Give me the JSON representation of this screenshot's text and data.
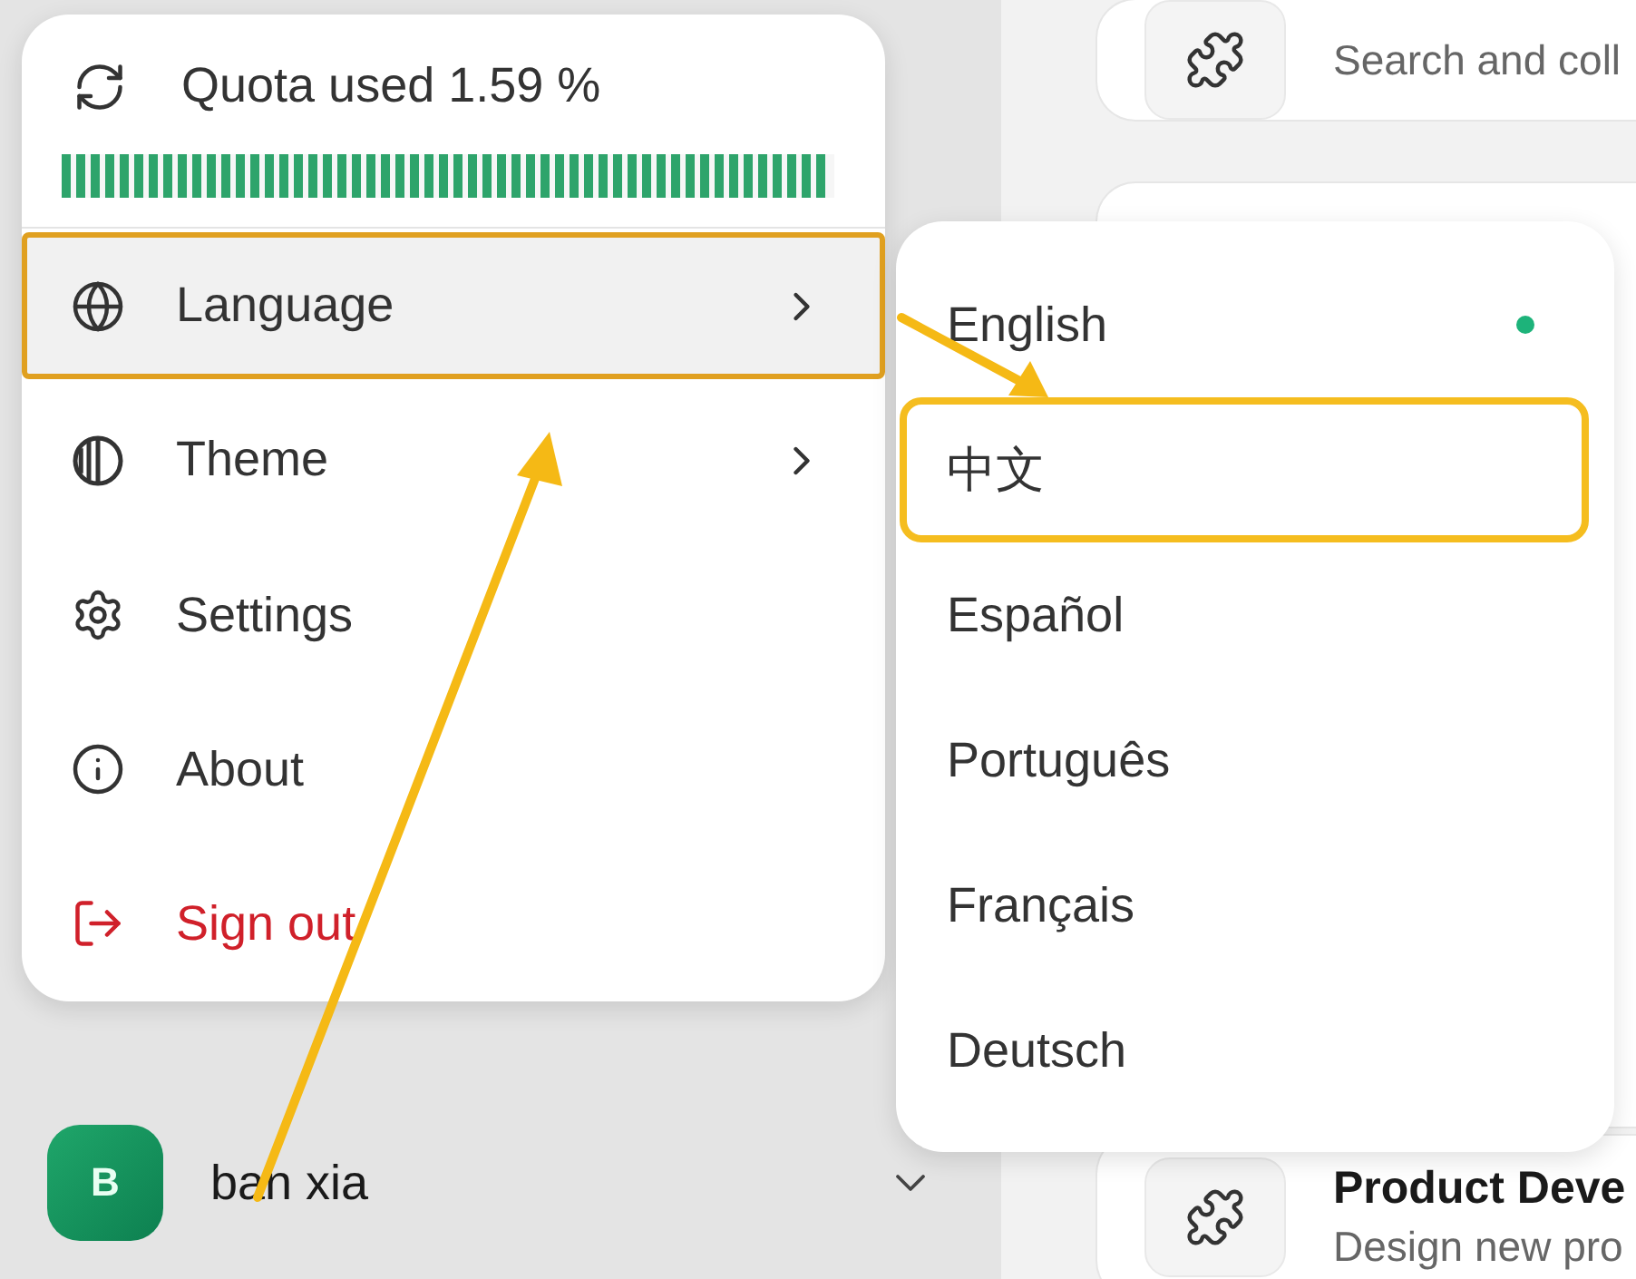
{
  "quota": {
    "label": "Quota used 1.59 %",
    "level": 0.99
  },
  "menu": [
    {
      "kind": "language",
      "label": "Language",
      "submenu": true,
      "highlighted": true,
      "danger": false
    },
    {
      "kind": "theme",
      "label": "Theme",
      "submenu": true,
      "highlighted": false,
      "danger": false
    },
    {
      "kind": "settings",
      "label": "Settings",
      "submenu": false,
      "highlighted": false,
      "danger": false
    },
    {
      "kind": "about",
      "label": "About",
      "submenu": false,
      "highlighted": false,
      "danger": false
    },
    {
      "kind": "signout",
      "label": "Sign out",
      "submenu": false,
      "highlighted": false,
      "danger": true
    }
  ],
  "languages": [
    {
      "label": "English",
      "selected": true,
      "highlighted": false
    },
    {
      "label": "中文",
      "selected": false,
      "highlighted": true
    },
    {
      "label": "Español",
      "selected": false,
      "highlighted": false
    },
    {
      "label": "Português",
      "selected": false,
      "highlighted": false
    },
    {
      "label": "Français",
      "selected": false,
      "highlighted": false
    },
    {
      "label": "Deutsch",
      "selected": false,
      "highlighted": false
    }
  ],
  "user": {
    "initial": "B",
    "name": "ban xia"
  },
  "cards": [
    {
      "description": "Search and coll"
    },
    {
      "title": "Product Deve",
      "description": "Design new pro"
    }
  ]
}
